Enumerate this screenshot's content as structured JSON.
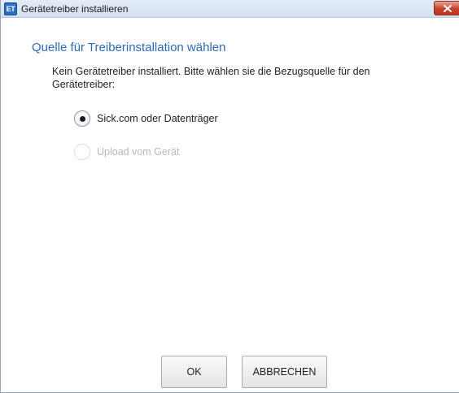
{
  "window": {
    "icon_text": "ET",
    "title": "Gerätetreiber installieren"
  },
  "main": {
    "heading": "Quelle für Treiberinstallation wählen",
    "description": "Kein Gerätetreiber installiert. Bitte wählen sie die Bezugsquelle für den Gerätetreiber:",
    "options": [
      {
        "label": "Sick.com oder Datenträger",
        "checked": true,
        "enabled": true
      },
      {
        "label": "Upload vom Gerät",
        "checked": false,
        "enabled": false
      }
    ]
  },
  "footer": {
    "ok_label": "OK",
    "cancel_label": "ABBRECHEN"
  },
  "colors": {
    "heading": "#2d6ab4",
    "close_button": "#c7402a",
    "titlebar": "#dce7f4"
  },
  "icons": {
    "app": "et-app-icon",
    "close": "close-icon"
  }
}
